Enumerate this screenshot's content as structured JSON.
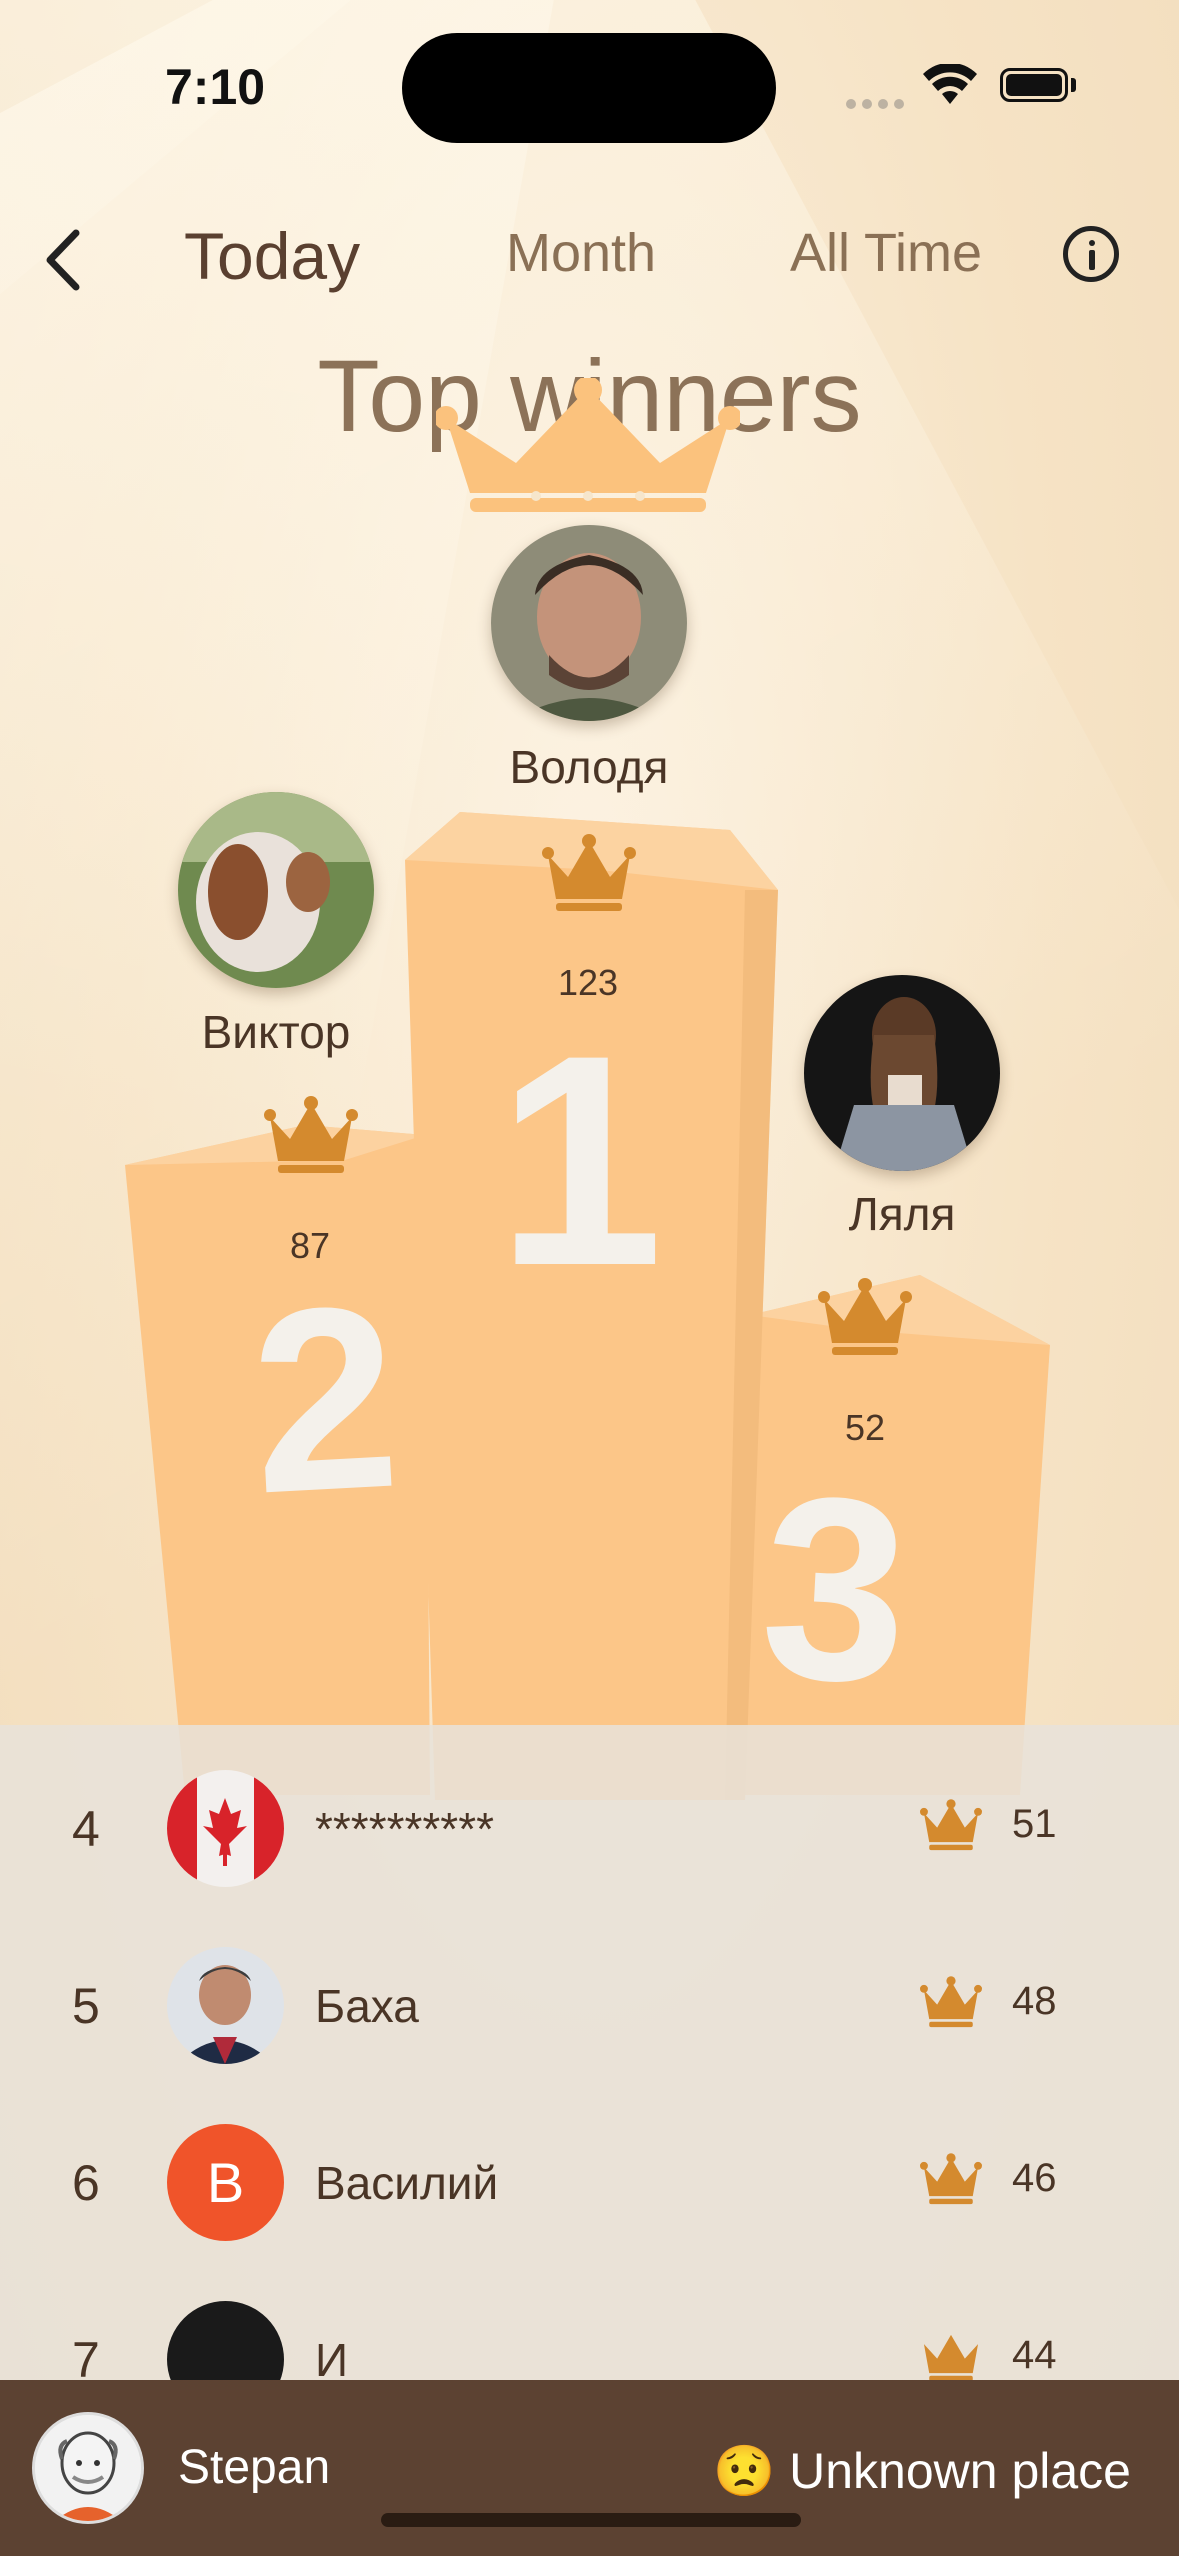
{
  "status_bar": {
    "time": "7:10"
  },
  "nav": {
    "tabs": [
      {
        "label": "Today",
        "active": true
      },
      {
        "label": "Month",
        "active": false
      },
      {
        "label": "All Time",
        "active": false
      }
    ],
    "back_icon": "chevron-left-icon",
    "info_icon": "info-icon"
  },
  "title": "Top winners",
  "podium": {
    "first": {
      "rank": "1",
      "name": "Володя",
      "score": "123"
    },
    "second": {
      "rank": "2",
      "name": "Виктор",
      "score": "87"
    },
    "third": {
      "rank": "3",
      "name": "Ляля",
      "score": "52"
    }
  },
  "list": [
    {
      "rank": "4",
      "name": "**********",
      "score": "51",
      "avatar": "canada-flag"
    },
    {
      "rank": "5",
      "name": "Баха",
      "score": "48",
      "avatar": "photo"
    },
    {
      "rank": "6",
      "name": "Василий",
      "score": "46",
      "avatar": "letter",
      "initial": "В"
    },
    {
      "rank": "7",
      "name": "И",
      "score": "44",
      "avatar": "dark-photo"
    }
  ],
  "me": {
    "name": "Stepan",
    "place": "😟 Unknown place"
  },
  "colors": {
    "accent": "#fcc688",
    "crown": "#d48a2e",
    "footer": "#5c4232",
    "letter_avatar": "#f0542a"
  }
}
